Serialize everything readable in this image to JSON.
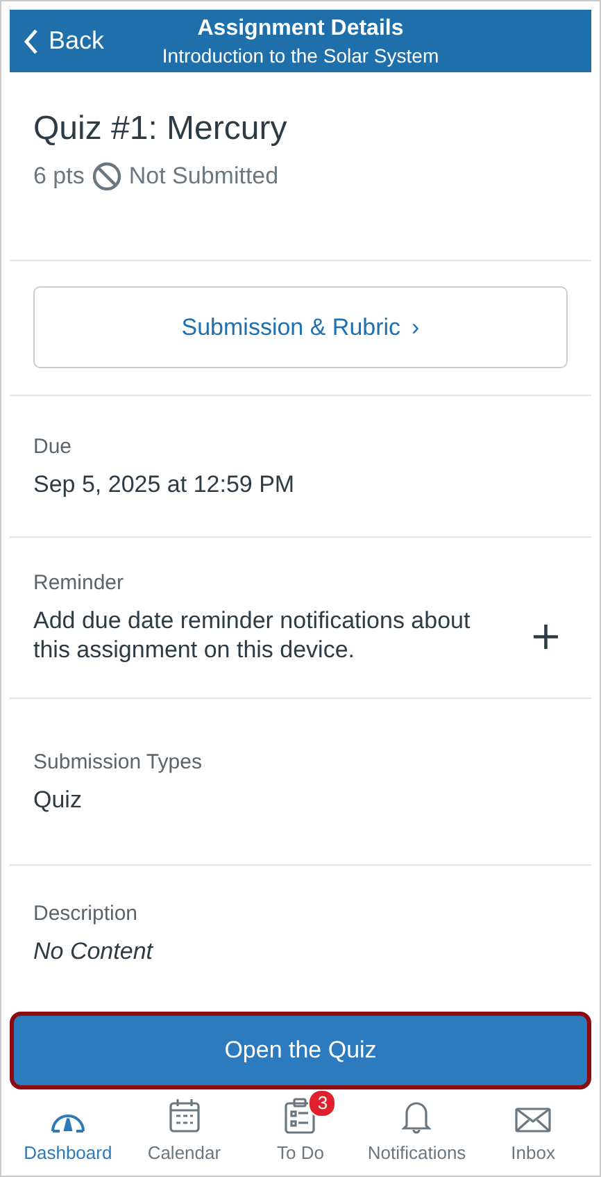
{
  "header": {
    "back": "Back",
    "title": "Assignment Details",
    "subtitle": "Introduction to the Solar System"
  },
  "assignment": {
    "title": "Quiz #1: Mercury",
    "points": "6 pts",
    "status": "Not Submitted"
  },
  "submission_button": {
    "label": "Submission & Rubric",
    "chevron": "›"
  },
  "sections": [
    {
      "kind": "text",
      "label": "Due",
      "value": "Sep 5, 2025 at 12:59 PM"
    },
    {
      "kind": "reminder",
      "label": "Reminder",
      "value": "Add due date reminder notifications about this assignment on this device.",
      "action": "+"
    },
    {
      "kind": "text",
      "label": "Submission Types",
      "value": "Quiz"
    },
    {
      "kind": "italic",
      "label": "Description",
      "value": "No Content"
    }
  ],
  "open_button": {
    "label": "Open the Quiz",
    "highlighted": true
  },
  "tabs": [
    {
      "kind": "dashboard",
      "label": "Dashboard",
      "selected": true
    },
    {
      "kind": "calendar",
      "label": "Calendar",
      "selected": false
    },
    {
      "kind": "todo",
      "label": "To Do",
      "selected": false,
      "badge": "3"
    },
    {
      "kind": "bell",
      "label": "Notifications",
      "selected": false
    },
    {
      "kind": "inbox",
      "label": "Inbox",
      "selected": false
    }
  ]
}
